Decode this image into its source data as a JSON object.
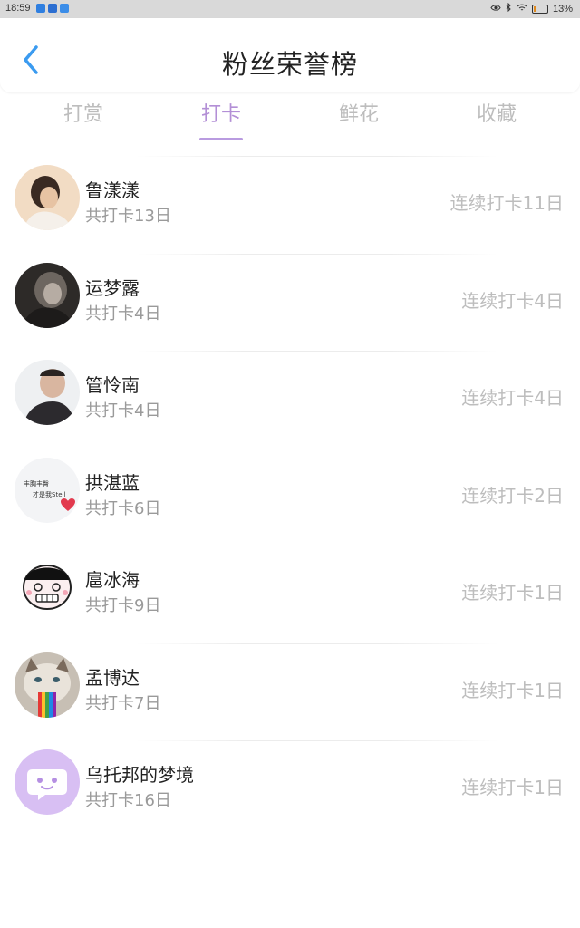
{
  "status_bar": {
    "time": "18:59",
    "battery": "13%",
    "battery_level": 0.13,
    "icons": [
      "eye-icon",
      "bluetooth-icon",
      "wifi-icon",
      "battery-icon"
    ]
  },
  "header": {
    "title": "粉丝荣誉榜",
    "back_icon": "chevron-left-icon"
  },
  "tabs": [
    {
      "label": "打赏",
      "active": false
    },
    {
      "label": "打卡",
      "active": true
    },
    {
      "label": "鲜花",
      "active": false
    },
    {
      "label": "收藏",
      "active": false
    }
  ],
  "fans": [
    {
      "name": "鲁漾漾",
      "total": "共打卡13日",
      "streak": "连续打卡11日"
    },
    {
      "name": "运梦露",
      "total": "共打卡4日",
      "streak": "连续打卡4日"
    },
    {
      "name": "管怜南",
      "total": "共打卡4日",
      "streak": "连续打卡4日"
    },
    {
      "name": "拱湛蓝",
      "total": "共打卡6日",
      "streak": "连续打卡2日",
      "avatar_text": [
        "丰胸丰臀",
        "才是我Steil"
      ]
    },
    {
      "name": "扈冰海",
      "total": "共打卡9日",
      "streak": "连续打卡1日"
    },
    {
      "name": "孟博达",
      "total": "共打卡7日",
      "streak": "连续打卡1日"
    },
    {
      "name": "乌托邦的梦境",
      "total": "共打卡16日",
      "streak": "连续打卡1日"
    }
  ],
  "colors": {
    "accent": "#b38fd6",
    "tab_inactive": "#bdbdbd",
    "streak_text": "#bdbdbd",
    "default_avatar": "#d8bff3"
  }
}
